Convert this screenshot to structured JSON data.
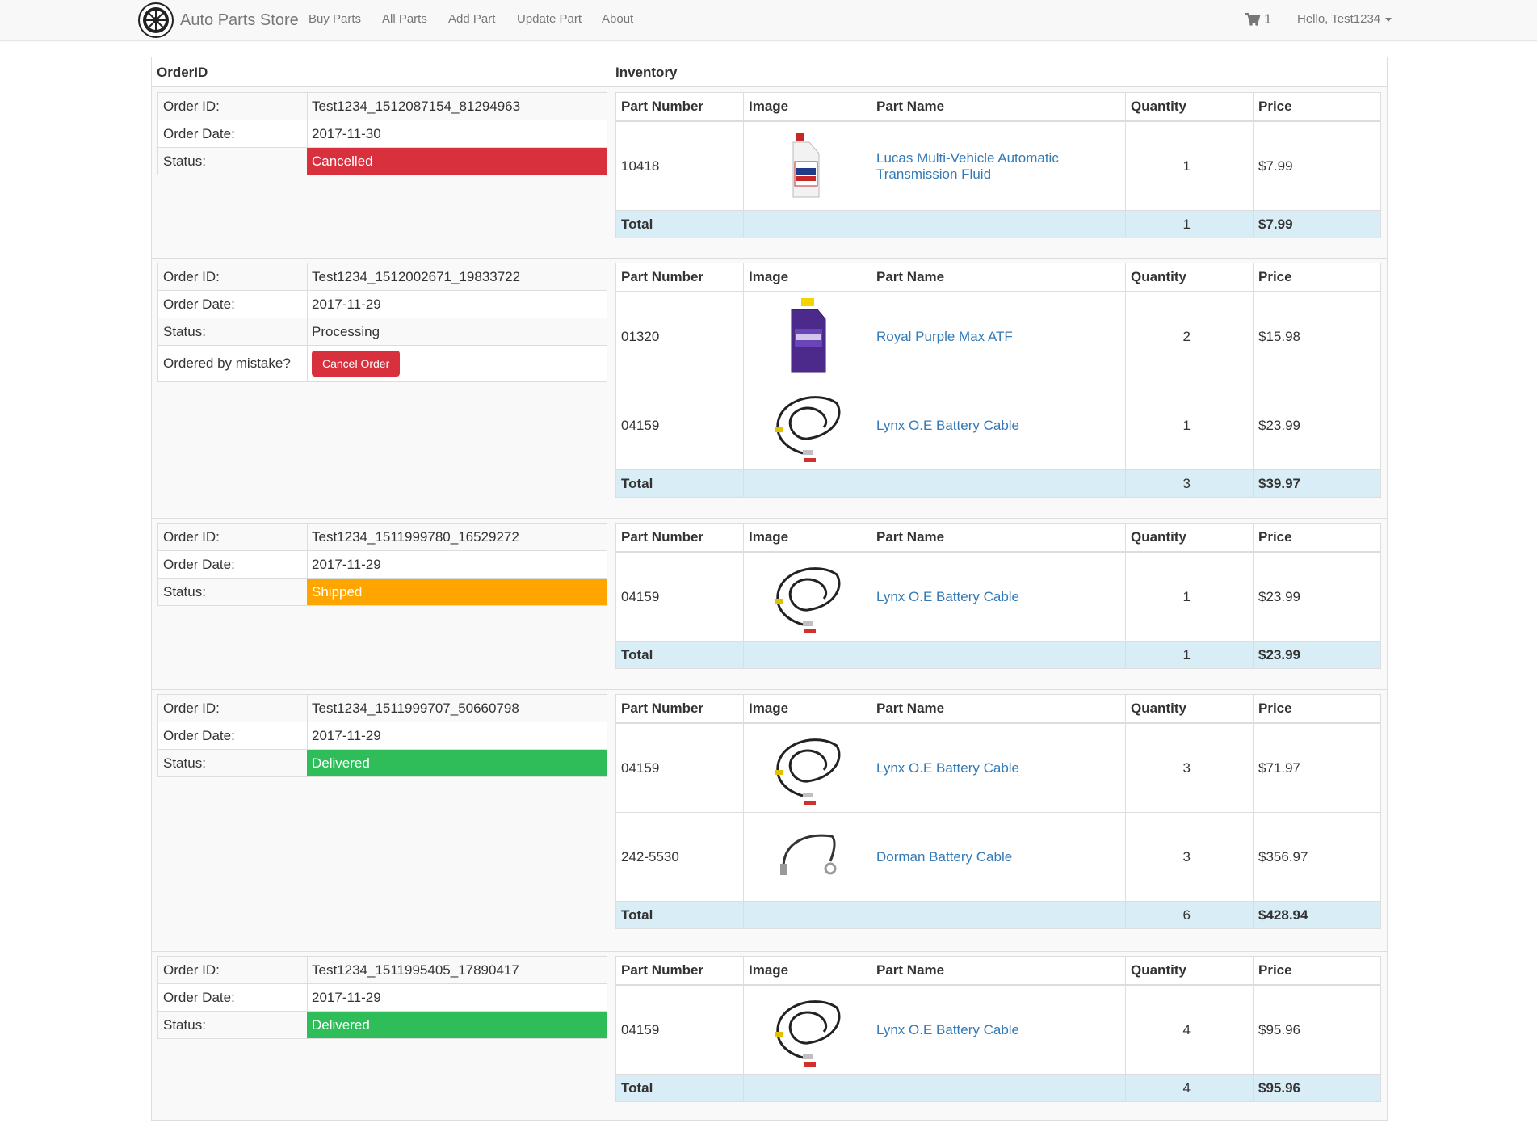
{
  "navbar": {
    "brand": "Auto Parts Store",
    "links": [
      "Buy Parts",
      "All Parts",
      "Add Part",
      "Update Part",
      "About"
    ],
    "cart_count": "1",
    "user_greeting": "Hello, Test1234"
  },
  "headers": {
    "order_id": "OrderID",
    "inventory": "Inventory"
  },
  "labels": {
    "order_id": "Order ID:",
    "order_date": "Order Date:",
    "status": "Status:",
    "mistake": "Ordered by mistake?",
    "cancel_button": "Cancel Order",
    "total": "Total"
  },
  "inventory_columns": [
    "Part Number",
    "Image",
    "Part Name",
    "Quantity",
    "Price"
  ],
  "colors": {
    "cancelled": "#d9303e",
    "shipped": "#ffa500",
    "delivered": "#2fbd5a",
    "link": "#337ab7",
    "total_row": "#d9edf7"
  },
  "orders": [
    {
      "id": "Test1234_1512087154_81294963",
      "date": "2017-11-30",
      "status": "Cancelled",
      "items": [
        {
          "part_number": "10418",
          "image": "fluid-bottle-image",
          "name": "Lucas Multi-Vehicle Automatic Transmission Fluid",
          "quantity": "1",
          "price": "$7.99"
        }
      ],
      "total_quantity": "1",
      "total_price": "$7.99"
    },
    {
      "id": "Test1234_1512002671_19833722",
      "date": "2017-11-29",
      "status": "Processing",
      "items": [
        {
          "part_number": "01320",
          "image": "atf-bottle-image",
          "name": "Royal Purple Max ATF",
          "quantity": "2",
          "price": "$15.98"
        },
        {
          "part_number": "04159",
          "image": "battery-cable-image",
          "name": "Lynx O.E Battery Cable",
          "quantity": "1",
          "price": "$23.99"
        }
      ],
      "total_quantity": "3",
      "total_price": "$39.97"
    },
    {
      "id": "Test1234_1511999780_16529272",
      "date": "2017-11-29",
      "status": "Shipped",
      "items": [
        {
          "part_number": "04159",
          "image": "battery-cable-image",
          "name": "Lynx O.E Battery Cable",
          "quantity": "1",
          "price": "$23.99"
        }
      ],
      "total_quantity": "1",
      "total_price": "$23.99"
    },
    {
      "id": "Test1234_1511999707_50660798",
      "date": "2017-11-29",
      "status": "Delivered",
      "items": [
        {
          "part_number": "04159",
          "image": "battery-cable-image",
          "name": "Lynx O.E Battery Cable",
          "quantity": "3",
          "price": "$71.97"
        },
        {
          "part_number": "242-5530",
          "image": "dorman-cable-image",
          "name": "Dorman Battery Cable",
          "quantity": "3",
          "price": "$356.97"
        }
      ],
      "total_quantity": "6",
      "total_price": "$428.94"
    },
    {
      "id": "Test1234_1511995405_17890417",
      "date": "2017-11-29",
      "status": "Delivered",
      "items": [
        {
          "part_number": "04159",
          "image": "battery-cable-image",
          "name": "Lynx O.E Battery Cable",
          "quantity": "4",
          "price": "$95.96"
        }
      ],
      "total_quantity": "4",
      "total_price": "$95.96"
    }
  ]
}
